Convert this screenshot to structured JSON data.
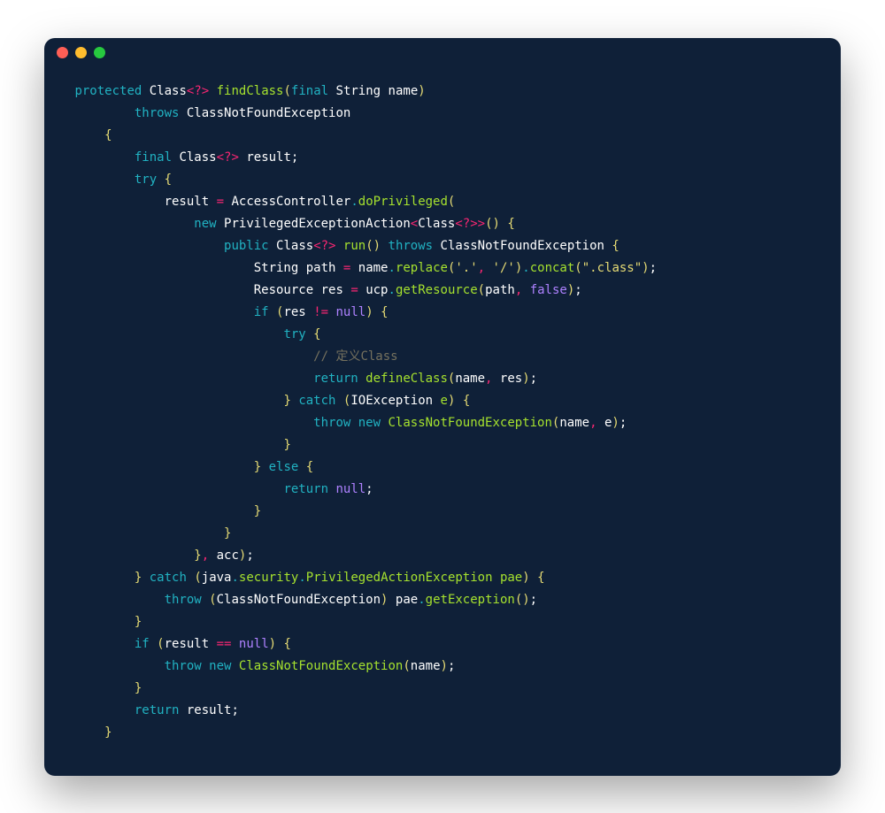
{
  "colors": {
    "background": "#0f2038",
    "keyword": "#21b2c2",
    "operator": "#f92672",
    "string": "#e6db74",
    "function": "#a6e22e",
    "comment": "#75715e",
    "constant": "#ae81ff",
    "text": "#e6e6e6"
  },
  "tokens": [
    [
      [
        " ",
        "p"
      ],
      [
        "protected",
        "k"
      ],
      [
        " ",
        "p"
      ],
      [
        "Class",
        "n"
      ],
      [
        "<?>",
        "o"
      ],
      [
        " ",
        "p"
      ],
      [
        "findClass",
        "fn"
      ],
      [
        "(",
        "y"
      ],
      [
        "final",
        "k"
      ],
      [
        " ",
        "p"
      ],
      [
        "String",
        "n"
      ],
      [
        " ",
        "p"
      ],
      [
        "name",
        "n"
      ],
      [
        ")",
        "y"
      ]
    ],
    [
      [
        "         ",
        "p"
      ],
      [
        "throws",
        "k"
      ],
      [
        " ",
        "p"
      ],
      [
        "ClassNotFoundException",
        "n"
      ]
    ],
    [
      [
        "     ",
        "p"
      ],
      [
        "{",
        "y"
      ]
    ],
    [
      [
        "         ",
        "p"
      ],
      [
        "final",
        "k"
      ],
      [
        " ",
        "p"
      ],
      [
        "Class",
        "n"
      ],
      [
        "<?>",
        "o"
      ],
      [
        " ",
        "p"
      ],
      [
        "result",
        "n"
      ],
      [
        ";",
        "n"
      ]
    ],
    [
      [
        "         ",
        "p"
      ],
      [
        "try",
        "k"
      ],
      [
        " ",
        "p"
      ],
      [
        "{",
        "y"
      ]
    ],
    [
      [
        "             ",
        "p"
      ],
      [
        "result",
        "n"
      ],
      [
        " ",
        "p"
      ],
      [
        "=",
        "o"
      ],
      [
        " ",
        "p"
      ],
      [
        "AccessController",
        "n"
      ],
      [
        ".",
        "d"
      ],
      [
        "doPrivileged",
        "fn"
      ],
      [
        "(",
        "y"
      ]
    ],
    [
      [
        "                 ",
        "p"
      ],
      [
        "new",
        "k"
      ],
      [
        " ",
        "p"
      ],
      [
        "PrivilegedExceptionAction",
        "n"
      ],
      [
        "<",
        "o"
      ],
      [
        "Class",
        "n"
      ],
      [
        "<?>>",
        "o"
      ],
      [
        "()",
        "y"
      ],
      [
        " ",
        "p"
      ],
      [
        "{",
        "y"
      ]
    ],
    [
      [
        "                     ",
        "p"
      ],
      [
        "public",
        "k"
      ],
      [
        " ",
        "p"
      ],
      [
        "Class",
        "n"
      ],
      [
        "<?>",
        "o"
      ],
      [
        " ",
        "p"
      ],
      [
        "run",
        "fn"
      ],
      [
        "()",
        "y"
      ],
      [
        " ",
        "p"
      ],
      [
        "throws",
        "k"
      ],
      [
        " ",
        "p"
      ],
      [
        "ClassNotFoundException",
        "n"
      ],
      [
        " ",
        "p"
      ],
      [
        "{",
        "y"
      ]
    ],
    [
      [
        "                         ",
        "p"
      ],
      [
        "String",
        "n"
      ],
      [
        " ",
        "p"
      ],
      [
        "path",
        "n"
      ],
      [
        " ",
        "p"
      ],
      [
        "=",
        "o"
      ],
      [
        " ",
        "p"
      ],
      [
        "name",
        "n"
      ],
      [
        ".",
        "d"
      ],
      [
        "replace",
        "fn"
      ],
      [
        "(",
        "y"
      ],
      [
        "'.'",
        "s"
      ],
      [
        ",",
        "o"
      ],
      [
        " ",
        "p"
      ],
      [
        "'/'",
        "s"
      ],
      [
        ")",
        "y"
      ],
      [
        ".",
        "d"
      ],
      [
        "concat",
        "fn"
      ],
      [
        "(",
        "y"
      ],
      [
        "\".class\"",
        "s"
      ],
      [
        ")",
        "y"
      ],
      [
        ";",
        "n"
      ]
    ],
    [
      [
        "                         ",
        "p"
      ],
      [
        "Resource",
        "n"
      ],
      [
        " ",
        "p"
      ],
      [
        "res",
        "n"
      ],
      [
        " ",
        "p"
      ],
      [
        "=",
        "o"
      ],
      [
        " ",
        "p"
      ],
      [
        "ucp",
        "n"
      ],
      [
        ".",
        "d"
      ],
      [
        "getResource",
        "fn"
      ],
      [
        "(",
        "y"
      ],
      [
        "path",
        "n"
      ],
      [
        ",",
        "o"
      ],
      [
        " ",
        "p"
      ],
      [
        "false",
        "b"
      ],
      [
        ")",
        "y"
      ],
      [
        ";",
        "n"
      ]
    ],
    [
      [
        "                         ",
        "p"
      ],
      [
        "if",
        "k"
      ],
      [
        " ",
        "p"
      ],
      [
        "(",
        "y"
      ],
      [
        "res",
        "n"
      ],
      [
        " ",
        "p"
      ],
      [
        "!=",
        "o"
      ],
      [
        " ",
        "p"
      ],
      [
        "null",
        "b"
      ],
      [
        ")",
        "y"
      ],
      [
        " ",
        "p"
      ],
      [
        "{",
        "y"
      ]
    ],
    [
      [
        "                             ",
        "p"
      ],
      [
        "try",
        "k"
      ],
      [
        " ",
        "p"
      ],
      [
        "{",
        "y"
      ]
    ],
    [
      [
        "                                 ",
        "p"
      ],
      [
        "// 定义Class",
        "c"
      ]
    ],
    [
      [
        "                                 ",
        "p"
      ],
      [
        "return",
        "k"
      ],
      [
        " ",
        "p"
      ],
      [
        "defineClass",
        "fn"
      ],
      [
        "(",
        "y"
      ],
      [
        "name",
        "n"
      ],
      [
        ",",
        "o"
      ],
      [
        " ",
        "p"
      ],
      [
        "res",
        "n"
      ],
      [
        ")",
        "y"
      ],
      [
        ";",
        "n"
      ]
    ],
    [
      [
        "                             ",
        "p"
      ],
      [
        "}",
        "y"
      ],
      [
        " ",
        "p"
      ],
      [
        "catch",
        "k"
      ],
      [
        " ",
        "p"
      ],
      [
        "(",
        "y"
      ],
      [
        "IOException",
        "n"
      ],
      [
        " ",
        "p"
      ],
      [
        "e",
        "fn"
      ],
      [
        ")",
        "y"
      ],
      [
        " ",
        "p"
      ],
      [
        "{",
        "y"
      ]
    ],
    [
      [
        "                                 ",
        "p"
      ],
      [
        "throw",
        "k"
      ],
      [
        " ",
        "p"
      ],
      [
        "new",
        "k"
      ],
      [
        " ",
        "p"
      ],
      [
        "ClassNotFoundException",
        "fn"
      ],
      [
        "(",
        "y"
      ],
      [
        "name",
        "n"
      ],
      [
        ",",
        "o"
      ],
      [
        " ",
        "p"
      ],
      [
        "e",
        "n"
      ],
      [
        ")",
        "y"
      ],
      [
        ";",
        "n"
      ]
    ],
    [
      [
        "                             ",
        "p"
      ],
      [
        "}",
        "y"
      ]
    ],
    [
      [
        "                         ",
        "p"
      ],
      [
        "}",
        "y"
      ],
      [
        " ",
        "p"
      ],
      [
        "else",
        "k"
      ],
      [
        " ",
        "p"
      ],
      [
        "{",
        "y"
      ]
    ],
    [
      [
        "                             ",
        "p"
      ],
      [
        "return",
        "k"
      ],
      [
        " ",
        "p"
      ],
      [
        "null",
        "b"
      ],
      [
        ";",
        "n"
      ]
    ],
    [
      [
        "                         ",
        "p"
      ],
      [
        "}",
        "y"
      ]
    ],
    [
      [
        "                     ",
        "p"
      ],
      [
        "}",
        "y"
      ]
    ],
    [
      [
        "                 ",
        "p"
      ],
      [
        "}",
        "y"
      ],
      [
        ",",
        "o"
      ],
      [
        " ",
        "p"
      ],
      [
        "acc",
        "n"
      ],
      [
        ")",
        "y"
      ],
      [
        ";",
        "n"
      ]
    ],
    [
      [
        "         ",
        "p"
      ],
      [
        "}",
        "y"
      ],
      [
        " ",
        "p"
      ],
      [
        "catch",
        "k"
      ],
      [
        " ",
        "p"
      ],
      [
        "(",
        "y"
      ],
      [
        "java",
        "n"
      ],
      [
        ".",
        "d"
      ],
      [
        "security",
        "fn"
      ],
      [
        ".",
        "d"
      ],
      [
        "PrivilegedActionException",
        "fn"
      ],
      [
        " ",
        "p"
      ],
      [
        "pae",
        "fn"
      ],
      [
        ")",
        "y"
      ],
      [
        " ",
        "p"
      ],
      [
        "{",
        "y"
      ]
    ],
    [
      [
        "             ",
        "p"
      ],
      [
        "throw",
        "k"
      ],
      [
        " ",
        "p"
      ],
      [
        "(",
        "y"
      ],
      [
        "ClassNotFoundException",
        "n"
      ],
      [
        ")",
        "y"
      ],
      [
        " ",
        "p"
      ],
      [
        "pae",
        "n"
      ],
      [
        ".",
        "d"
      ],
      [
        "getException",
        "fn"
      ],
      [
        "()",
        "y"
      ],
      [
        ";",
        "n"
      ]
    ],
    [
      [
        "         ",
        "p"
      ],
      [
        "}",
        "y"
      ]
    ],
    [
      [
        "         ",
        "p"
      ],
      [
        "if",
        "k"
      ],
      [
        " ",
        "p"
      ],
      [
        "(",
        "y"
      ],
      [
        "result",
        "n"
      ],
      [
        " ",
        "p"
      ],
      [
        "==",
        "o"
      ],
      [
        " ",
        "p"
      ],
      [
        "null",
        "b"
      ],
      [
        ")",
        "y"
      ],
      [
        " ",
        "p"
      ],
      [
        "{",
        "y"
      ]
    ],
    [
      [
        "             ",
        "p"
      ],
      [
        "throw",
        "k"
      ],
      [
        " ",
        "p"
      ],
      [
        "new",
        "k"
      ],
      [
        " ",
        "p"
      ],
      [
        "ClassNotFoundException",
        "fn"
      ],
      [
        "(",
        "y"
      ],
      [
        "name",
        "n"
      ],
      [
        ")",
        "y"
      ],
      [
        ";",
        "n"
      ]
    ],
    [
      [
        "         ",
        "p"
      ],
      [
        "}",
        "y"
      ]
    ],
    [
      [
        "         ",
        "p"
      ],
      [
        "return",
        "k"
      ],
      [
        " ",
        "p"
      ],
      [
        "result",
        "n"
      ],
      [
        ";",
        "n"
      ]
    ],
    [
      [
        "     ",
        "p"
      ],
      [
        "}",
        "y"
      ]
    ]
  ]
}
